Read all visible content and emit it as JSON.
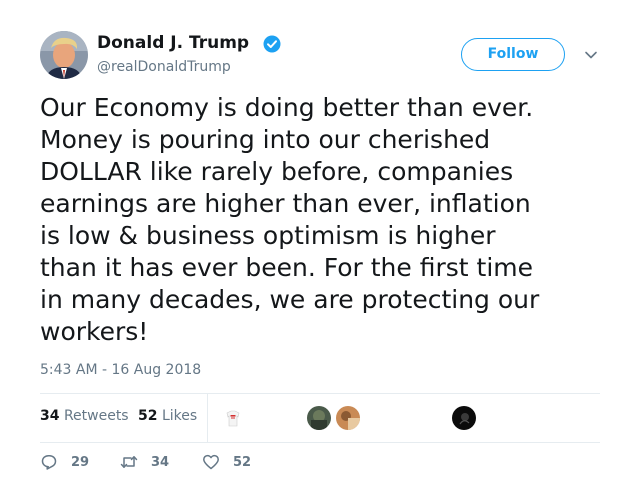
{
  "author": {
    "name": "Donald J. Trump",
    "handle": "@realDonaldTrump",
    "verified": true
  },
  "header": {
    "follow_label": "Follow"
  },
  "tweet": {
    "lines": [
      "Our Economy is doing better than ever.",
      "Money is pouring into our cherished",
      "DOLLAR like rarely before, companies",
      "earnings are higher than ever, inflation",
      "is low & business optimism is higher",
      "than it has ever been. For the first time",
      "in many decades, we are protecting our",
      "workers!"
    ],
    "timestamp": "5:43 AM - 16 Aug 2018"
  },
  "stats": {
    "retweets_count": "34",
    "retweets_label": "Retweets",
    "likes_count": "52",
    "likes_label": "Likes"
  },
  "actions": {
    "reply_count": "29",
    "retweet_count": "34",
    "like_count": "52"
  },
  "colors": {
    "accent": "#1da1f2",
    "text_primary": "#14171a",
    "text_secondary": "#657786",
    "divider": "#e6ecf0"
  },
  "icons": {
    "verified": "verified-badge-icon",
    "caret": "chevron-down-icon",
    "reply": "reply-icon",
    "retweet": "retweet-icon",
    "like": "heart-icon"
  }
}
